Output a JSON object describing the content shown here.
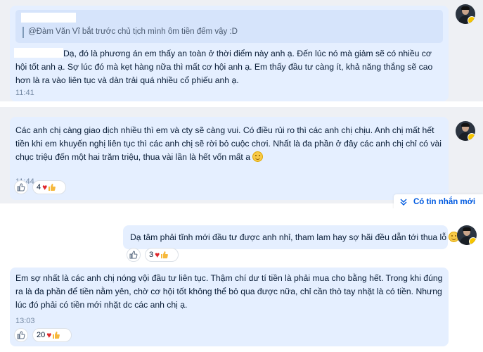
{
  "messages": [
    {
      "quote": "@Đàm Văn Vĩ bắt trước chủ tịch mình ôm tiền đếm vậy :D",
      "text": "Dạ, đó là phương án em thấy an toàn ở thời điểm này anh ạ. Đến lúc nó mà giảm sẽ có nhiều cơ hội tốt anh ạ. Sợ lúc đó mà kẹt hàng nữa thì mất cơ hội anh ạ. Em thấy đầu tư càng ít, khả năng thắng sẽ cao hơn là ra vào liên tục và dàn trải quá nhiều cổ phiếu anh ạ.",
      "time": "11:41"
    },
    {
      "text": "Các anh chị càng giao dịch nhiều thì em và cty sẽ càng vui. Có điều rủi ro thì các anh chị chịu. Anh chị mất hết tiền khi em khuyến nghị liên tục thì các anh chị sẽ rời bỏ cuộc chơi. Nhất là đa phần ở đây các anh chị chỉ có vài chục triệu đến một hai trăm triệu, thua vài lần là hết vốn mất a",
      "time": "11:44",
      "reaction_count": "4"
    },
    {
      "text": "Dạ tâm phải tĩnh mới đầu tư được anh nhỉ, tham lam hay sợ hãi đều dẫn tới thua lỗ",
      "reaction_count": "3"
    },
    {
      "text": "Em sợ nhất là các anh chị nóng vội đầu tư liên tục. Thậm chí dư tí tiền là phải mua cho bằng hết. Trong khi đúng ra là đa phần để tiền nằm yên, chờ cơ hội tốt không thể bỏ qua được nữa, chỉ cần thò tay nhặt là có tiền. Nhưng lúc đó phải có tiền mới nhặt dc các anh chị ạ.",
      "time": "13:03",
      "reaction_count": "20"
    }
  ],
  "new_messages_label": "Có tin nhắn mới",
  "icons": {
    "like": "thumbs-up-icon",
    "heart": "heart-icon",
    "chevron": "double-chevron-down-icon",
    "emoji": "smile-emoji-icon"
  },
  "colors": {
    "bubble": "#e5efff",
    "link": "#005ae0",
    "heart": "#e0262b"
  }
}
